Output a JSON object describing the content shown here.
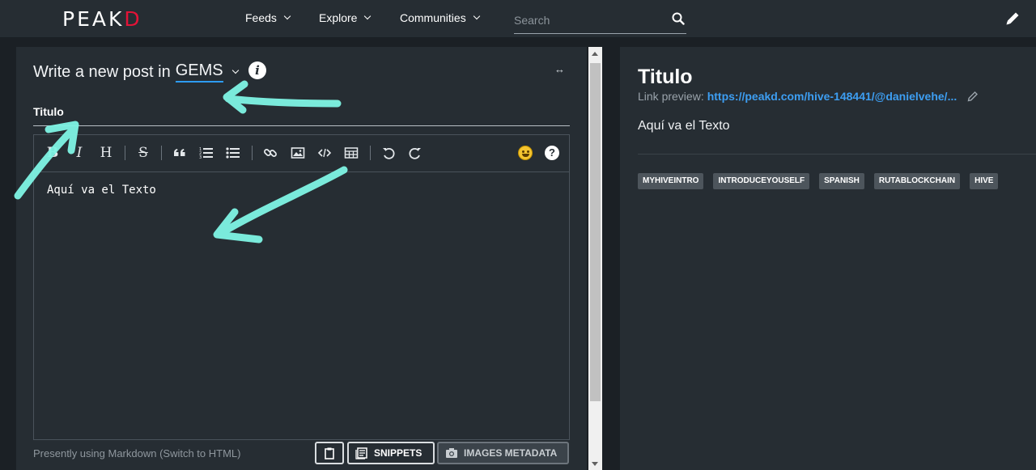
{
  "header": {
    "logo_main": "PEAK",
    "logo_accent": "D",
    "nav": [
      {
        "label": "Feeds"
      },
      {
        "label": "Explore"
      },
      {
        "label": "Communities"
      }
    ],
    "search_placeholder": "Search"
  },
  "editor": {
    "heading_prefix": "Write a new post in",
    "community": "GEMS",
    "expand_glyph": "↔",
    "title_value": "Titulo",
    "body_value": "Aquí va el Texto",
    "toolbar_labels": {
      "bold": "B",
      "italic": "I",
      "heading": "H",
      "strike": "S"
    },
    "mode_note": "Presently using Markdown (Switch to HTML)",
    "buttons": {
      "snippets": "SNIPPETS",
      "images_metadata": "IMAGES METADATA"
    }
  },
  "preview": {
    "title": "Titulo",
    "link_label": "Link preview:",
    "link_url": "https://peakd.com/hive-148441/@danielvehe/...",
    "body": "Aquí va el Texto",
    "tags": [
      "MYHIVEINTRO",
      "INTRODUCEYOUSELF",
      "SPANISH",
      "RUTABLOCKCHAIN",
      "HIVE"
    ]
  },
  "colors": {
    "brand_red": "#e31337",
    "link_blue": "#3d9ef2",
    "panel": "#262d33",
    "background": "#1b2025",
    "annotation": "#7ff5e4"
  }
}
